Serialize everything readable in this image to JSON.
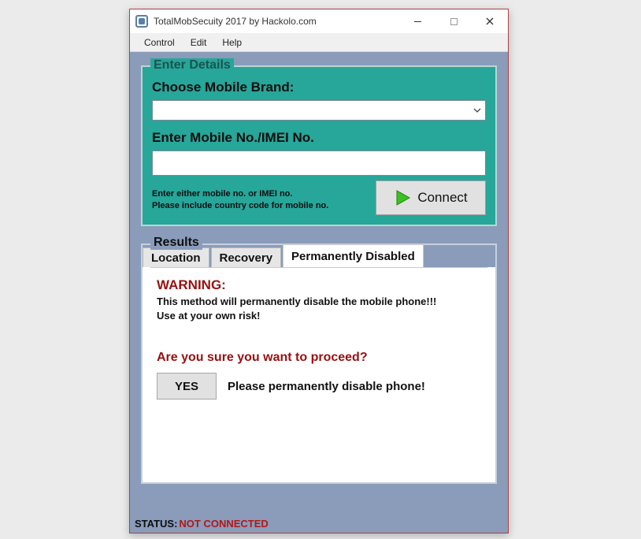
{
  "window": {
    "title": "TotalMobSecuity 2017 by Hackolo.com"
  },
  "menubar": {
    "items": [
      "Control",
      "Edit",
      "Help"
    ]
  },
  "enter_details": {
    "legend": "Enter Details",
    "brand_label": "Choose Mobile Brand:",
    "brand_selected": "",
    "imei_label": "Enter Mobile No./IMEI No.",
    "imei_value": "",
    "hint_line1": "Enter either mobile no. or IMEI no.",
    "hint_line2": "Please include country code for mobile no.",
    "connect_label": "Connect"
  },
  "results": {
    "legend": "Results",
    "tabs": [
      {
        "label": "Location",
        "active": false
      },
      {
        "label": "Recovery",
        "active": false
      },
      {
        "label": "Permanently Disabled",
        "active": true
      }
    ],
    "warning_title": "WARNING:",
    "warning_body_line1": "This method will permanently disable the mobile phone!!!",
    "warning_body_line2": "Use at your own risk!",
    "confirm_question": "Are you sure you want to proceed?",
    "yes_label": "YES",
    "yes_caption": "Please permanently disable phone!"
  },
  "status": {
    "label": "STATUS:",
    "value": "NOT CONNECTED"
  }
}
